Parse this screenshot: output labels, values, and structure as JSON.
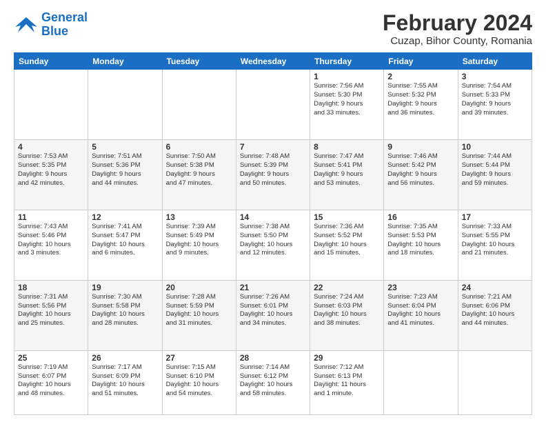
{
  "header": {
    "logo_line1": "General",
    "logo_line2": "Blue",
    "title": "February 2024",
    "subtitle": "Cuzap, Bihor County, Romania"
  },
  "days_of_week": [
    "Sunday",
    "Monday",
    "Tuesday",
    "Wednesday",
    "Thursday",
    "Friday",
    "Saturday"
  ],
  "weeks": [
    {
      "shaded": false,
      "days": [
        {
          "num": "",
          "info": ""
        },
        {
          "num": "",
          "info": ""
        },
        {
          "num": "",
          "info": ""
        },
        {
          "num": "",
          "info": ""
        },
        {
          "num": "1",
          "info": "Sunrise: 7:56 AM\nSunset: 5:30 PM\nDaylight: 9 hours\nand 33 minutes."
        },
        {
          "num": "2",
          "info": "Sunrise: 7:55 AM\nSunset: 5:32 PM\nDaylight: 9 hours\nand 36 minutes."
        },
        {
          "num": "3",
          "info": "Sunrise: 7:54 AM\nSunset: 5:33 PM\nDaylight: 9 hours\nand 39 minutes."
        }
      ]
    },
    {
      "shaded": true,
      "days": [
        {
          "num": "4",
          "info": "Sunrise: 7:53 AM\nSunset: 5:35 PM\nDaylight: 9 hours\nand 42 minutes."
        },
        {
          "num": "5",
          "info": "Sunrise: 7:51 AM\nSunset: 5:36 PM\nDaylight: 9 hours\nand 44 minutes."
        },
        {
          "num": "6",
          "info": "Sunrise: 7:50 AM\nSunset: 5:38 PM\nDaylight: 9 hours\nand 47 minutes."
        },
        {
          "num": "7",
          "info": "Sunrise: 7:48 AM\nSunset: 5:39 PM\nDaylight: 9 hours\nand 50 minutes."
        },
        {
          "num": "8",
          "info": "Sunrise: 7:47 AM\nSunset: 5:41 PM\nDaylight: 9 hours\nand 53 minutes."
        },
        {
          "num": "9",
          "info": "Sunrise: 7:46 AM\nSunset: 5:42 PM\nDaylight: 9 hours\nand 56 minutes."
        },
        {
          "num": "10",
          "info": "Sunrise: 7:44 AM\nSunset: 5:44 PM\nDaylight: 9 hours\nand 59 minutes."
        }
      ]
    },
    {
      "shaded": false,
      "days": [
        {
          "num": "11",
          "info": "Sunrise: 7:43 AM\nSunset: 5:46 PM\nDaylight: 10 hours\nand 3 minutes."
        },
        {
          "num": "12",
          "info": "Sunrise: 7:41 AM\nSunset: 5:47 PM\nDaylight: 10 hours\nand 6 minutes."
        },
        {
          "num": "13",
          "info": "Sunrise: 7:39 AM\nSunset: 5:49 PM\nDaylight: 10 hours\nand 9 minutes."
        },
        {
          "num": "14",
          "info": "Sunrise: 7:38 AM\nSunset: 5:50 PM\nDaylight: 10 hours\nand 12 minutes."
        },
        {
          "num": "15",
          "info": "Sunrise: 7:36 AM\nSunset: 5:52 PM\nDaylight: 10 hours\nand 15 minutes."
        },
        {
          "num": "16",
          "info": "Sunrise: 7:35 AM\nSunset: 5:53 PM\nDaylight: 10 hours\nand 18 minutes."
        },
        {
          "num": "17",
          "info": "Sunrise: 7:33 AM\nSunset: 5:55 PM\nDaylight: 10 hours\nand 21 minutes."
        }
      ]
    },
    {
      "shaded": true,
      "days": [
        {
          "num": "18",
          "info": "Sunrise: 7:31 AM\nSunset: 5:56 PM\nDaylight: 10 hours\nand 25 minutes."
        },
        {
          "num": "19",
          "info": "Sunrise: 7:30 AM\nSunset: 5:58 PM\nDaylight: 10 hours\nand 28 minutes."
        },
        {
          "num": "20",
          "info": "Sunrise: 7:28 AM\nSunset: 5:59 PM\nDaylight: 10 hours\nand 31 minutes."
        },
        {
          "num": "21",
          "info": "Sunrise: 7:26 AM\nSunset: 6:01 PM\nDaylight: 10 hours\nand 34 minutes."
        },
        {
          "num": "22",
          "info": "Sunrise: 7:24 AM\nSunset: 6:03 PM\nDaylight: 10 hours\nand 38 minutes."
        },
        {
          "num": "23",
          "info": "Sunrise: 7:23 AM\nSunset: 6:04 PM\nDaylight: 10 hours\nand 41 minutes."
        },
        {
          "num": "24",
          "info": "Sunrise: 7:21 AM\nSunset: 6:06 PM\nDaylight: 10 hours\nand 44 minutes."
        }
      ]
    },
    {
      "shaded": false,
      "days": [
        {
          "num": "25",
          "info": "Sunrise: 7:19 AM\nSunset: 6:07 PM\nDaylight: 10 hours\nand 48 minutes."
        },
        {
          "num": "26",
          "info": "Sunrise: 7:17 AM\nSunset: 6:09 PM\nDaylight: 10 hours\nand 51 minutes."
        },
        {
          "num": "27",
          "info": "Sunrise: 7:15 AM\nSunset: 6:10 PM\nDaylight: 10 hours\nand 54 minutes."
        },
        {
          "num": "28",
          "info": "Sunrise: 7:14 AM\nSunset: 6:12 PM\nDaylight: 10 hours\nand 58 minutes."
        },
        {
          "num": "29",
          "info": "Sunrise: 7:12 AM\nSunset: 6:13 PM\nDaylight: 11 hours\nand 1 minute."
        },
        {
          "num": "",
          "info": ""
        },
        {
          "num": "",
          "info": ""
        }
      ]
    }
  ]
}
